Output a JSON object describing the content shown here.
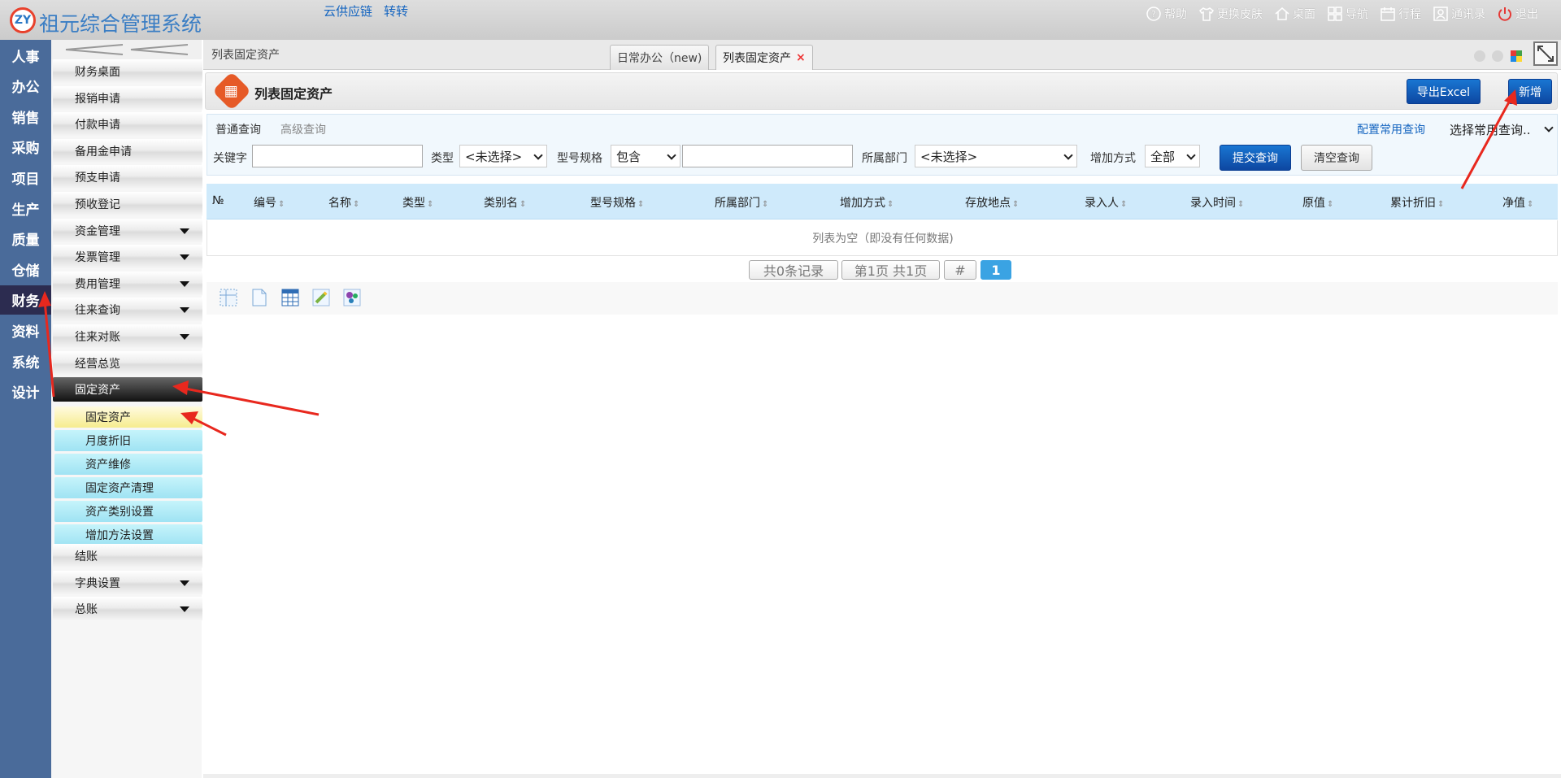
{
  "header": {
    "logo_text": "ZY",
    "app_title": "祖元综合管理系统",
    "links": [
      "云供应链",
      "转转"
    ],
    "right_items": [
      {
        "label": "帮助",
        "icon": "help-icon"
      },
      {
        "label": "更换皮肤",
        "icon": "shirt-icon"
      },
      {
        "label": "桌面",
        "icon": "home-icon"
      },
      {
        "label": "导航",
        "icon": "grid-icon"
      },
      {
        "label": "行程",
        "icon": "calendar-icon"
      },
      {
        "label": "通讯录",
        "icon": "contact-icon"
      },
      {
        "label": "退出",
        "icon": "power-icon"
      }
    ]
  },
  "categories": [
    "人事",
    "办公",
    "销售",
    "采购",
    "项目",
    "生产",
    "质量",
    "仓储",
    "财务",
    "资料",
    "系统",
    "设计"
  ],
  "active_category": "财务",
  "submenu": {
    "items": [
      {
        "label": "财务桌面"
      },
      {
        "label": "报销申请"
      },
      {
        "label": "付款申请"
      },
      {
        "label": "备用金申请"
      },
      {
        "label": "预支申请"
      },
      {
        "label": "预收登记"
      },
      {
        "label": "资金管理",
        "expandable": true
      },
      {
        "label": "发票管理",
        "expandable": true
      },
      {
        "label": "费用管理",
        "expandable": true
      },
      {
        "label": "往来查询",
        "expandable": true
      },
      {
        "label": "往来对账",
        "expandable": true
      },
      {
        "label": "经营总览"
      },
      {
        "label": "固定资产",
        "active": true
      }
    ],
    "children": [
      "固定资产",
      "月度折旧",
      "资产维修",
      "固定资产清理",
      "资产类别设置",
      "增加方法设置"
    ],
    "after": [
      {
        "label": "结账"
      },
      {
        "label": "字典设置",
        "expandable": true
      },
      {
        "label": "总账",
        "expandable": true
      }
    ]
  },
  "tabs": {
    "breadcrumb": "列表固定资产",
    "items": [
      "日常办公（new)",
      "列表固定资产"
    ],
    "close_glyph": "×"
  },
  "page": {
    "title": "列表固定资产",
    "export_label": "导出Excel",
    "add_label": "新增"
  },
  "query": {
    "tab_simple": "普通查询",
    "tab_advanced": "高级查询",
    "config_link": "配置常用查询",
    "saved_query": "选择常用查询..",
    "keyword_label": "关键字",
    "type_label": "类型",
    "type_value": "<未选择>",
    "spec_label": "型号规格",
    "spec_mode": "包含",
    "dept_label": "所属部门",
    "dept_value": "<未选择>",
    "add_method_label": "增加方式",
    "add_method_value": "全部",
    "submit_label": "提交查询",
    "clear_label": "清空查询"
  },
  "table": {
    "columns": [
      "№",
      "编号",
      "名称",
      "类型",
      "类别名",
      "型号规格",
      "所属部门",
      "增加方式",
      "存放地点",
      "录入人",
      "录入时间",
      "原值",
      "累计折旧",
      "净值"
    ],
    "sort_glyph": "⇕",
    "empty_text": "列表为空（即没有任何数据)"
  },
  "pager": {
    "total": "共0条记录",
    "page": "第1页 共1页",
    "hash": "#",
    "current": "1"
  },
  "colors": {
    "accent": "#1565c0",
    "category_bg": "#4a6b9a",
    "annotation": "#e8281e"
  }
}
